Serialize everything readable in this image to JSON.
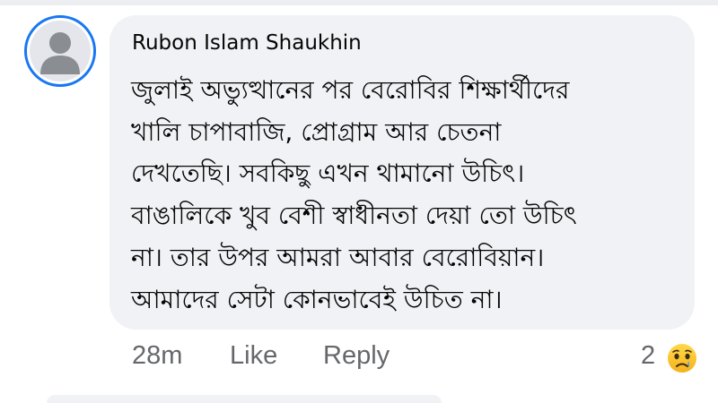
{
  "comment": {
    "author": "Rubon Islam Shaukhin",
    "lines": [
      "জুলাই অভ্যুত্থানের পর বেরোবির শিক্ষার্থীদের",
      "খালি চাপাবাজি, প্রোগ্রাম আর চেতনা",
      "দেখতেছি। সবকিছু এখন থামানো উচিৎ।",
      "বাঙালিকে খুব বেশী স্বাধীনতা দেয়া তো উচিৎ",
      "না। তার উপর আমরা আবার বেরোবিয়ান।",
      "আমাদের সেটা কোনভাবেই উচিত না।"
    ]
  },
  "actions": {
    "time": "28m",
    "like": "Like",
    "reply": "Reply"
  },
  "reactions": {
    "count": "2",
    "icon": "sad-emoji-icon"
  }
}
